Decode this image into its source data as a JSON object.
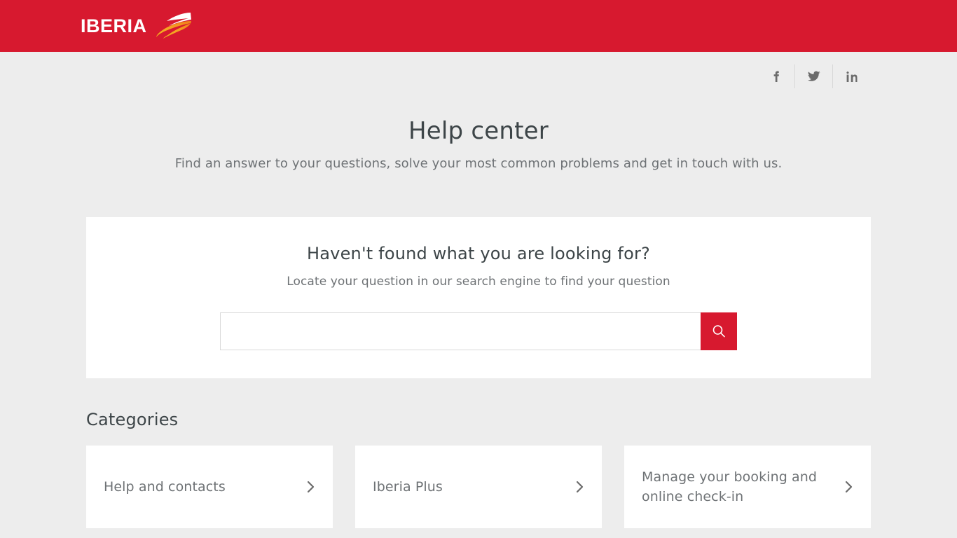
{
  "brand": {
    "name": "IBERIA",
    "logo_icon": "iberia-swoosh-logo",
    "header_color": "#d7192f",
    "accent_color": "#d7192f",
    "page_background": "#ededed"
  },
  "social": {
    "items": [
      {
        "icon": "facebook-icon",
        "label": "f"
      },
      {
        "icon": "twitter-icon",
        "label": ""
      },
      {
        "icon": "linkedin-icon",
        "label": "in"
      }
    ]
  },
  "hero": {
    "title": "Help center",
    "subtitle": "Find an answer to your questions, solve your most common problems and get in touch with us."
  },
  "search": {
    "heading": "Haven't found what you are looking for?",
    "description": "Locate your question in our search engine to find your question",
    "input_value": "",
    "placeholder": "",
    "button_icon": "search-icon"
  },
  "categories": {
    "title": "Categories",
    "items": [
      {
        "label": "Help and contacts",
        "chevron": "chevron-right-icon"
      },
      {
        "label": "Iberia Plus",
        "chevron": "chevron-right-icon"
      },
      {
        "label": "Manage your booking and online check-in",
        "chevron": "chevron-right-icon"
      }
    ]
  }
}
